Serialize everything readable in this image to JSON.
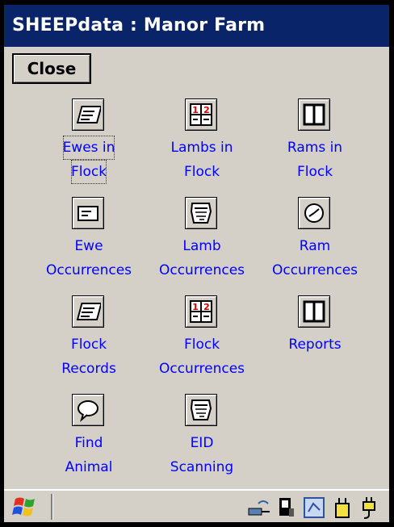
{
  "window": {
    "title": "SHEEPdata : Manor Farm"
  },
  "toolbar": {
    "close_label": "Close"
  },
  "menu": [
    {
      "name": "ewes-in-flock",
      "icon": "address-card-icon",
      "line1": "Ewes in",
      "line2": "Flock"
    },
    {
      "name": "lambs-in-flock",
      "icon": "calculator-icon",
      "line1": "Lambs in",
      "line2": "Flock"
    },
    {
      "name": "rams-in-flock",
      "icon": "book-icon",
      "line1": "Rams in",
      "line2": "Flock"
    },
    {
      "name": "ewe-occurrences",
      "icon": "envelope-icon",
      "line1": "Ewe",
      "line2": "Occurrences"
    },
    {
      "name": "lamb-occurrences",
      "icon": "scanner-icon",
      "line1": "Lamb",
      "line2": "Occurrences"
    },
    {
      "name": "ram-occurrences",
      "icon": "clock-icon",
      "line1": "Ram",
      "line2": "Occurrences"
    },
    {
      "name": "flock-records",
      "icon": "address-card-icon",
      "line1": "Flock",
      "line2": "Records"
    },
    {
      "name": "flock-occurrences",
      "icon": "calculator-icon",
      "line1": "Flock",
      "line2": "Occurrences"
    },
    {
      "name": "reports",
      "icon": "book-icon",
      "line1": "Reports",
      "line2": ""
    },
    {
      "name": "find-animal",
      "icon": "speech-bubble-icon",
      "line1": "Find",
      "line2": "Animal"
    },
    {
      "name": "eid-scanning",
      "icon": "scanner-icon",
      "line1": "EID",
      "line2": "Scanning"
    }
  ],
  "taskbar": {
    "start_icon": "windows-flag-icon",
    "tray_icons": [
      "network-icon",
      "pda-icon",
      "sync-icon",
      "battery-icon",
      "power-plug-icon"
    ]
  },
  "colors": {
    "title_bar": "#0a246a",
    "link_text": "#0000ff",
    "surface": "#d4d0c8"
  }
}
